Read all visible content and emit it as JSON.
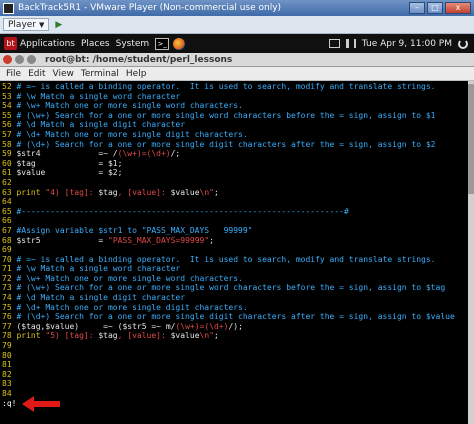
{
  "vm": {
    "title": "BackTrack5R1 - VMware Player (Non-commercial use only)",
    "player_label": "Player",
    "min": "–",
    "max": "□",
    "close": "x"
  },
  "panel": {
    "logo": "bt",
    "menu": [
      "Applications",
      "Places",
      "System"
    ],
    "terminal_icon": ">_",
    "clock": "Tue Apr  9, 11:00 PM"
  },
  "terminal": {
    "title": "root@bt: /home/student/perl_lessons",
    "menu": [
      "File",
      "Edit",
      "View",
      "Terminal",
      "Help"
    ]
  },
  "editor": {
    "lines": [
      {
        "n": "52",
        "segs": [
          [
            "cm",
            "# =~ is called a binding operator.  It is used to search, modify and translate strings."
          ]
        ]
      },
      {
        "n": "53",
        "segs": [
          [
            "cm",
            "# \\w Match a single word character"
          ]
        ]
      },
      {
        "n": "54",
        "segs": [
          [
            "cm",
            "# \\w+ Match one or more single word characters."
          ]
        ]
      },
      {
        "n": "55",
        "segs": [
          [
            "cm",
            "# (\\w+) Search for a one or more single word characters before the = sign, assign to $1"
          ]
        ]
      },
      {
        "n": "56",
        "segs": [
          [
            "cm",
            "# \\d Match a single digit character"
          ]
        ]
      },
      {
        "n": "57",
        "segs": [
          [
            "cm",
            "# \\d+ Match one or more single digit characters."
          ]
        ]
      },
      {
        "n": "58",
        "segs": [
          [
            "cm",
            "# (\\d+) Search for a one or more single digit characters after the = sign, assign to $2"
          ]
        ]
      },
      {
        "n": "59",
        "segs": [
          [
            "var",
            "$str4"
          ],
          [
            "var",
            "            =~ /"
          ],
          [
            "str",
            "(\\w+)=(\\d+)"
          ],
          [
            "var",
            "/;"
          ]
        ]
      },
      {
        "n": "60",
        "segs": [
          [
            "var",
            "$tag"
          ],
          [
            "var",
            "             = $1;"
          ]
        ]
      },
      {
        "n": "61",
        "segs": [
          [
            "var",
            "$value"
          ],
          [
            "var",
            "           = $2;"
          ]
        ]
      },
      {
        "n": "62",
        "segs": [
          [
            "var",
            ""
          ]
        ]
      },
      {
        "n": "63",
        "segs": [
          [
            "kw",
            "print"
          ],
          [
            "str",
            " \"4) [tag]: "
          ],
          [
            "var",
            "$tag"
          ],
          [
            "str",
            ", [value]: "
          ],
          [
            "var",
            "$value"
          ],
          [
            "str",
            "\\n\""
          ],
          [
            "var",
            ";"
          ]
        ]
      },
      {
        "n": "64",
        "segs": [
          [
            "var",
            ""
          ]
        ]
      },
      {
        "n": "65",
        "segs": [
          [
            "cm",
            "#-------------------------------------------------------------------#"
          ]
        ]
      },
      {
        "n": "66",
        "segs": [
          [
            "var",
            ""
          ]
        ]
      },
      {
        "n": "67",
        "segs": [
          [
            "cm",
            "#Assign variable $str1 to \"PASS_MAX_DAYS   99999\""
          ]
        ]
      },
      {
        "n": "68",
        "segs": [
          [
            "var",
            "$str5"
          ],
          [
            "var",
            "            = "
          ],
          [
            "str",
            "\"PASS_MAX_DAYS=99999\""
          ],
          [
            "var",
            ";"
          ]
        ]
      },
      {
        "n": "69",
        "segs": [
          [
            "var",
            ""
          ]
        ]
      },
      {
        "n": "70",
        "segs": [
          [
            "cm",
            "# =~ is called a binding operator.  It is used to search, modify and translate strings."
          ]
        ]
      },
      {
        "n": "71",
        "segs": [
          [
            "cm",
            "# \\w Match a single word character"
          ]
        ]
      },
      {
        "n": "72",
        "segs": [
          [
            "cm",
            "# \\w+ Match one or more single word characters."
          ]
        ]
      },
      {
        "n": "73",
        "segs": [
          [
            "cm",
            "# (\\w+) Search for a one or more single word characters before the = sign, assign to $tag"
          ]
        ]
      },
      {
        "n": "74",
        "segs": [
          [
            "cm",
            "# \\d Match a single digit character"
          ]
        ]
      },
      {
        "n": "75",
        "segs": [
          [
            "cm",
            "# \\d+ Match one or more single digit characters."
          ]
        ]
      },
      {
        "n": "76",
        "segs": [
          [
            "cm",
            "# (\\d+) Search for a one or more single digit characters after the = sign, assign to $value"
          ]
        ]
      },
      {
        "n": "77",
        "segs": [
          [
            "var",
            "($tag,$value)"
          ],
          [
            "var",
            "     =~ ("
          ],
          [
            "var",
            "$str5"
          ],
          [
            "var",
            " =~ m/"
          ],
          [
            "str",
            "(\\w+)=(\\d+)"
          ],
          [
            "var",
            "/);"
          ]
        ]
      },
      {
        "n": "78",
        "segs": [
          [
            "kw",
            "print"
          ],
          [
            "str",
            " \"5) [tag]: "
          ],
          [
            "var",
            "$tag"
          ],
          [
            "str",
            ", [value]: "
          ],
          [
            "var",
            "$value"
          ],
          [
            "str",
            "\\n\""
          ],
          [
            "var",
            ";"
          ]
        ]
      },
      {
        "n": "79",
        "segs": [
          [
            "var",
            ""
          ]
        ]
      },
      {
        "n": "80",
        "segs": [
          [
            "var",
            ""
          ]
        ]
      },
      {
        "n": "81",
        "segs": [
          [
            "var",
            ""
          ]
        ]
      },
      {
        "n": "82",
        "segs": [
          [
            "var",
            ""
          ]
        ]
      },
      {
        "n": "83",
        "segs": [
          [
            "var",
            ""
          ]
        ]
      },
      {
        "n": "84",
        "segs": [
          [
            "var",
            ""
          ]
        ]
      }
    ],
    "command": ":q!"
  },
  "colors": {
    "line_number": "#d8c21a",
    "comment": "#39aefc",
    "string": "#e04848",
    "annotation_arrow": "#e01818"
  }
}
